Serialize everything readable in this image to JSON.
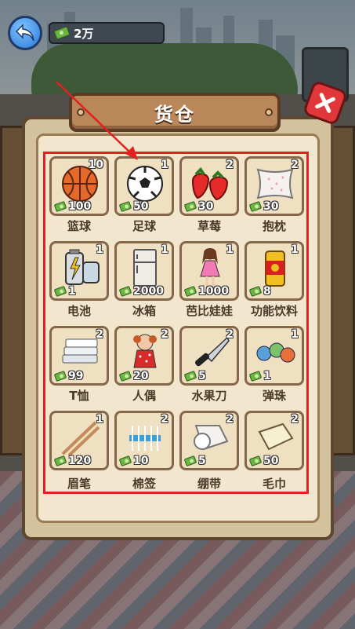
{
  "header": {
    "money": "2万",
    "title": "货仓"
  },
  "icons": {
    "back": "back-arrow-icon",
    "cash": "cash-icon",
    "close": "close-icon"
  },
  "colors": {
    "highlight": "#e2201d",
    "panel": "#f2e6cf",
    "cash": "#69b640"
  },
  "items": [
    {
      "name": "篮球",
      "count": "10",
      "price": "100",
      "icon": "basketball-icon"
    },
    {
      "name": "足球",
      "count": "1",
      "price": "50",
      "icon": "soccer-ball-icon"
    },
    {
      "name": "草莓",
      "count": "2",
      "price": "30",
      "icon": "strawberry-icon"
    },
    {
      "name": "抱枕",
      "count": "2",
      "price": "30",
      "icon": "pillow-icon"
    },
    {
      "name": "电池",
      "count": "1",
      "price": "1",
      "icon": "battery-icon"
    },
    {
      "name": "冰箱",
      "count": "1",
      "price": "2000",
      "icon": "fridge-icon"
    },
    {
      "name": "芭比娃娃",
      "count": "1",
      "price": "1000",
      "icon": "barbie-doll-icon"
    },
    {
      "name": "功能饮料",
      "count": "1",
      "price": "8",
      "icon": "energy-drink-icon"
    },
    {
      "name": "T恤",
      "count": "2",
      "price": "99",
      "icon": "tshirt-stack-icon"
    },
    {
      "name": "人偶",
      "count": "2",
      "price": "20",
      "icon": "doll-icon"
    },
    {
      "name": "水果刀",
      "count": "2",
      "price": "5",
      "icon": "knife-icon"
    },
    {
      "name": "弹珠",
      "count": "1",
      "price": "1",
      "icon": "marbles-icon"
    },
    {
      "name": "眉笔",
      "count": "1",
      "price": "120",
      "icon": "eyebrow-pencil-icon"
    },
    {
      "name": "棉签",
      "count": "2",
      "price": "10",
      "icon": "cotton-swab-icon"
    },
    {
      "name": "绷带",
      "count": "2",
      "price": "5",
      "icon": "bandage-icon"
    },
    {
      "name": "毛巾",
      "count": "2",
      "price": "50",
      "icon": "towel-icon"
    }
  ]
}
